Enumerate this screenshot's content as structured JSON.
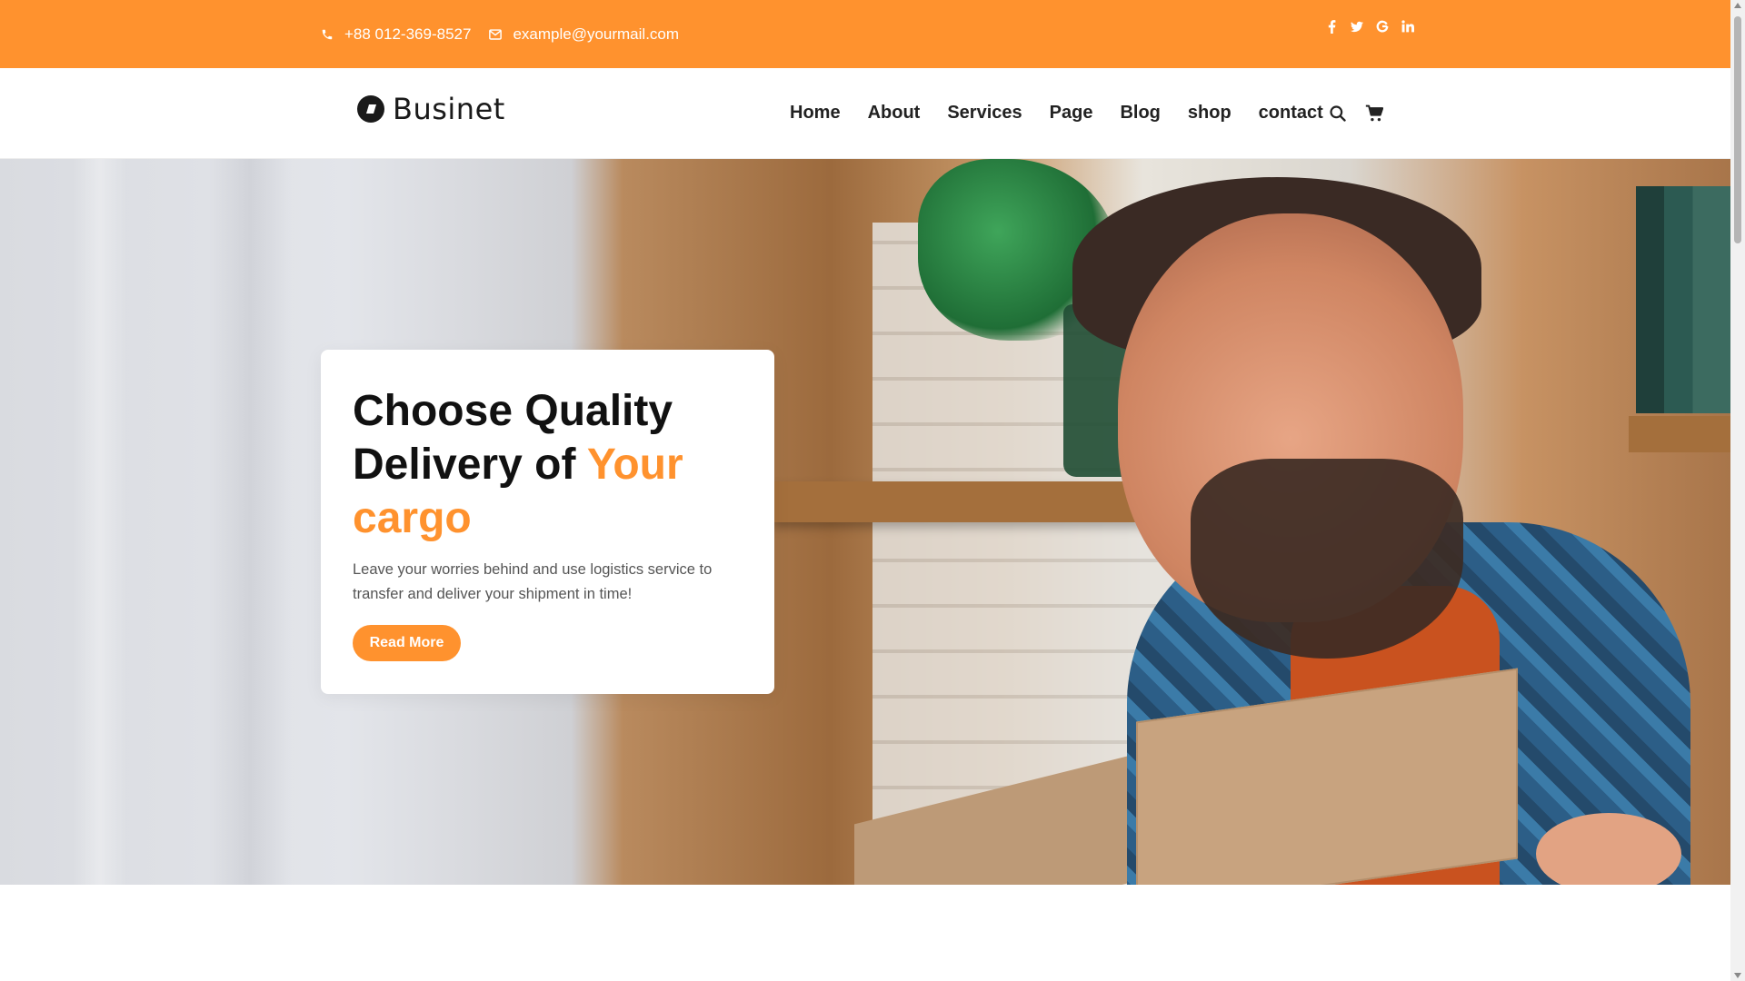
{
  "topbar": {
    "phone": "+88 012-369-8527",
    "email": "example@yourmail.com",
    "social": [
      {
        "name": "facebook-icon",
        "glyph": "f"
      },
      {
        "name": "twitter-icon",
        "glyph": "t"
      },
      {
        "name": "google-icon",
        "glyph": "G"
      },
      {
        "name": "linkedin-icon",
        "glyph": "in"
      }
    ],
    "color": "#ff922e"
  },
  "header": {
    "brand": "Businet",
    "nav": [
      "Home",
      "About",
      "Services",
      "Page",
      "Blog",
      "shop",
      "contact"
    ],
    "tools": [
      "search-icon",
      "cart-icon"
    ]
  },
  "hero": {
    "title_line1": "Choose Quality",
    "title_line2_plain": "Delivery of",
    "title_line2_accent": "Your",
    "title_line3_accent": "cargo",
    "description": "Leave your worries behind and use logistics service to transfer and deliver your shipment in time!",
    "cta": "Read More",
    "accent_color": "#ff922e"
  }
}
